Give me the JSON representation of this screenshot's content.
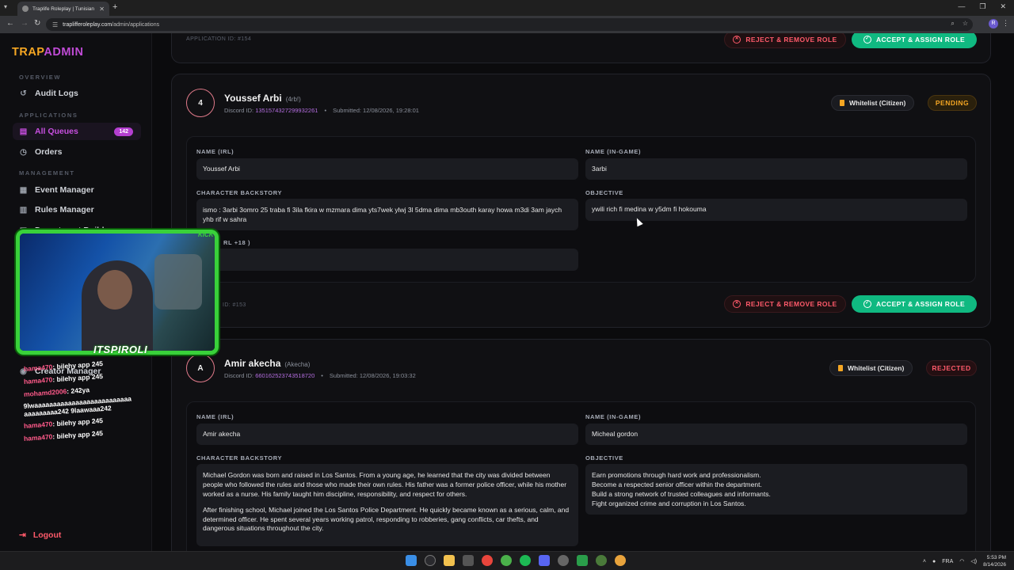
{
  "browser": {
    "tab_title": "Traplife Roleplay | Tunisian GTA...",
    "url_host": "traplifferoleplay.com",
    "url_path": "/admin/applications",
    "profile_initial": "R"
  },
  "sidebar": {
    "logo_trap": "TRAP",
    "logo_admin": "ADMIN",
    "section_overview": "OVERVIEW",
    "section_applications": "APPLICATIONS",
    "section_management": "MANAGEMENT",
    "items": [
      {
        "label": "Audit Logs",
        "icon": "history-icon"
      },
      {
        "label": "All Queues",
        "icon": "document-icon",
        "badge": "142"
      },
      {
        "label": "Orders",
        "icon": "clock-icon"
      },
      {
        "label": "Event Manager",
        "icon": "calendar-icon"
      },
      {
        "label": "Rules Manager",
        "icon": "book-icon"
      },
      {
        "label": "Department Builder",
        "icon": "building-icon"
      },
      {
        "label": "Creator Manager",
        "icon": "user-icon"
      }
    ],
    "logout": "Logout"
  },
  "top_card": {
    "app_id": "APPLICATION ID: #154",
    "reject_label": "REJECT & REMOVE ROLE",
    "accept_label": "ACCEPT & ASSIGN ROLE"
  },
  "applications": [
    {
      "avatar": "4",
      "name": "Youssef Arbi",
      "handle": "(4rb!)",
      "discord_label": "Discord ID:",
      "discord_id": "1351574327299932261",
      "submitted": "Submitted: 12/08/2026, 19:28:01",
      "role_tag": "Whitelist (Citizen)",
      "status": "PENDING",
      "name_irl_label": "NAME (IRL)",
      "name_irl": "Youssef Arbi",
      "name_game_label": "NAME (IN-GAME)",
      "name_game": "3arbi",
      "backstory_label": "CHARACTER BACKSTORY",
      "backstory": "ismo : 3arbi 3omro 25 traba fi 3ila fkira w mzmara dima yts7wek ylwj 3l 5dma  dima mb3outh karay howa m3di 3am jaych yhb rif w sahra",
      "objective_label": "OBJECTIVE",
      "objective": "ywili rich fi medina w y5dm fi hokouma",
      "age_label": "RL +18 )",
      "app_id": "ID: #153",
      "reject_label": "REJECT & REMOVE ROLE",
      "accept_label": "ACCEPT & ASSIGN ROLE"
    },
    {
      "avatar": "A",
      "name": "Amir akecha",
      "handle": "(Akecha)",
      "discord_label": "Discord ID:",
      "discord_id": "660162523743518720",
      "submitted": "Submitted: 12/08/2026, 19:03:32",
      "role_tag": "Whitelist (Citizen)",
      "status": "REJECTED",
      "name_irl_label": "NAME (IRL)",
      "name_irl": "Amir akecha",
      "name_game_label": "NAME (IN-GAME)",
      "name_game": "Micheal gordon",
      "backstory_label": "CHARACTER BACKSTORY",
      "backstory_p1": "Michael Gordon was born and raised in Los Santos. From a young age, he learned that the city was divided between people who followed the rules and those who made their own rules. His father was a former police officer, while his mother worked as a nurse. His family taught him discipline, responsibility, and respect for others.",
      "backstory_p2": "After finishing school, Michael joined the Los Santos Police Department. He quickly became known as a serious, calm, and determined officer. He spent several years working patrol, responding to robberies, gang conflicts, car thefts, and dangerous situations throughout the city.",
      "objective_label": "OBJECTIVE",
      "objective_lines": [
        "Earn promotions through hard work and professionalism.",
        "Become a respected senior officer within the department.",
        "Build a strong network of trusted colleagues and informants.",
        "Fight organized crime and corruption in Los Santos."
      ]
    }
  ],
  "stream": {
    "streamer": "ITSPIROLI",
    "platform": "KICK",
    "chat": [
      {
        "user": "hama470",
        "msg": ": bilehy app 245"
      },
      {
        "user": "hama470",
        "msg": ": bilehy app 245"
      },
      {
        "user": "mohamd2006",
        "msg": ": 242ya"
      },
      {
        "user": "",
        "msg": "9lwaaaaaaaaaaaaaaaaaaaaaaaaaa aaaaaaaaa242 9laawaaa242"
      },
      {
        "user": "hama470",
        "msg": ": bilehy app 245"
      },
      {
        "user": "hama470",
        "msg": ": bilehy app 245"
      }
    ]
  },
  "taskbar": {
    "lang": "FRA",
    "time": "5:53 PM",
    "date": "8/14/2026"
  },
  "colors": {
    "accent_purple": "#c04bd6",
    "logo_orange": "#f5a623",
    "accept_green": "#10b981",
    "reject_red": "#ff5a6a",
    "overlay_green": "#39d13a"
  }
}
